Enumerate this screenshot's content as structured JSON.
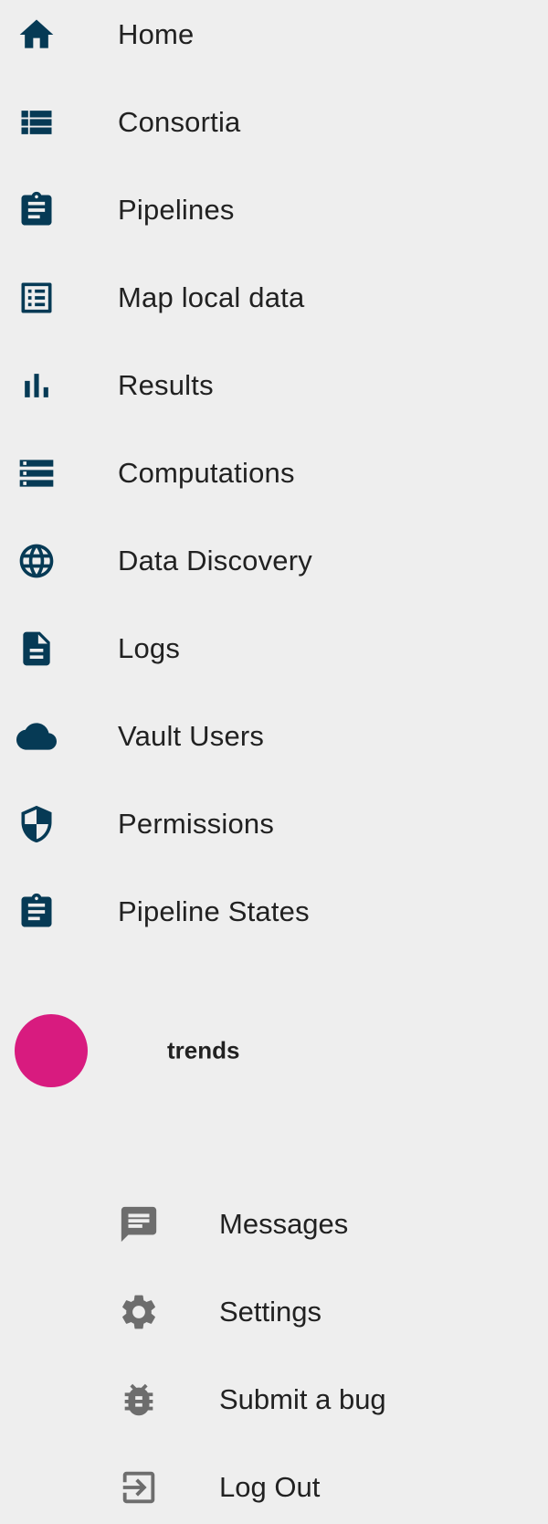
{
  "colors": {
    "icon_primary": "#063a55",
    "icon_secondary": "#6d6d6d",
    "background": "#eeeeee",
    "avatar": "#d81b7f",
    "text": "#212121"
  },
  "nav": {
    "items": [
      {
        "label": "Home",
        "icon": "home-icon"
      },
      {
        "label": "Consortia",
        "icon": "list-icon"
      },
      {
        "label": "Pipelines",
        "icon": "clipboard-icon"
      },
      {
        "label": "Map local data",
        "icon": "list-alt-icon"
      },
      {
        "label": "Results",
        "icon": "bar-chart-icon"
      },
      {
        "label": "Computations",
        "icon": "storage-icon"
      },
      {
        "label": "Data Discovery",
        "icon": "globe-icon"
      },
      {
        "label": "Logs",
        "icon": "document-icon"
      },
      {
        "label": "Vault Users",
        "icon": "cloud-icon"
      },
      {
        "label": "Permissions",
        "icon": "shield-icon"
      },
      {
        "label": "Pipeline States",
        "icon": "clipboard-icon"
      }
    ]
  },
  "user": {
    "name": "trends",
    "avatar_color": "#d81b7f"
  },
  "user_menu": {
    "items": [
      {
        "label": "Messages",
        "icon": "message-icon"
      },
      {
        "label": "Settings",
        "icon": "gear-icon"
      },
      {
        "label": "Submit a bug",
        "icon": "bug-icon"
      },
      {
        "label": "Log Out",
        "icon": "logout-icon"
      }
    ]
  }
}
